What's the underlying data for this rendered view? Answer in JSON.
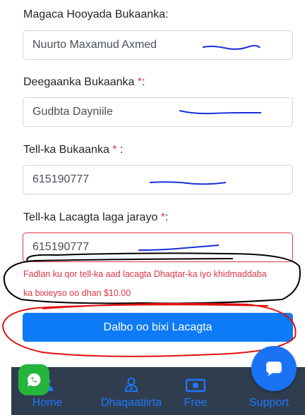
{
  "form": {
    "customer_name": {
      "label": "Magaca Hooyada Bukaanka:",
      "value": "Nuurto Maxamud Axmed"
    },
    "customer_area": {
      "label": "Deegaanka Bukaanka ",
      "required_mark": "*",
      "suffix": ":",
      "value": "Gudbta Dayniile"
    },
    "customer_phone": {
      "label": "Tell-ka Bukaanka ",
      "required_mark": "*",
      "suffix": " :",
      "value": "615190777"
    },
    "payment_phone": {
      "label": "Tell-ka Lacagta laga jarayo ",
      "required_mark": "*",
      "suffix": ":",
      "value": "615190777"
    },
    "error_message": "Fadlan ku qor tell-ka aad lacagta Dhaqtar-ka iyo khidmaddaba ka bixieyso oo dhan $10.00",
    "submit_label": "Dalbo oo bixi Lacagta"
  },
  "bottom_nav": {
    "items": [
      {
        "label": "Home",
        "icon": "user-icon"
      },
      {
        "label": "Dhaqaatiirta",
        "icon": "doctor-icon"
      },
      {
        "label": "Free",
        "icon": "money-icon"
      },
      {
        "label": "Support",
        "icon": "chat-icon"
      }
    ]
  },
  "colors": {
    "primary": "#0d7bf7",
    "danger": "#dc3545",
    "nav_bg": "#2f3d4f",
    "whatsapp": "#25b43c",
    "annotation_blue": "#1a2fd6",
    "annotation_red": "#e01010",
    "annotation_black": "#000000"
  }
}
